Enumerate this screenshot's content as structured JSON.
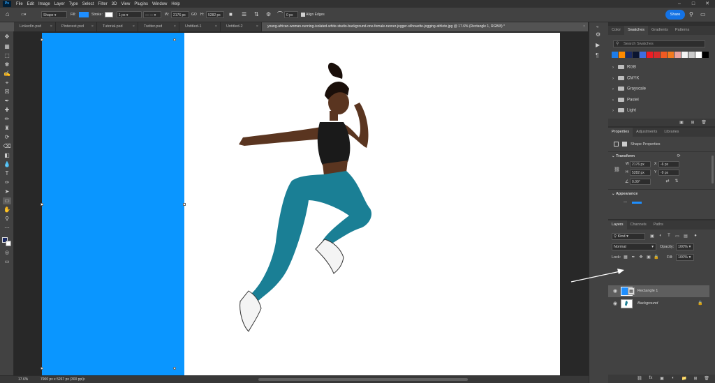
{
  "app": {
    "logo": "Ps",
    "menus": [
      "File",
      "Edit",
      "Image",
      "Layer",
      "Type",
      "Select",
      "Filter",
      "3D",
      "View",
      "Plugins",
      "Window",
      "Help"
    ]
  },
  "options_bar": {
    "tool_mode": "Shape",
    "fill_label": "Fill:",
    "stroke_label": "Stroke:",
    "stroke_width": "1 px",
    "w_label": "W:",
    "w_value": "2176 px",
    "link_icon": "GO",
    "h_label": "H:",
    "h_value": "5282 px",
    "radius_value": "0 px",
    "align_edges": "Align Edges",
    "share": "Share"
  },
  "tabs": [
    {
      "label": "LinkedIn.psd"
    },
    {
      "label": "Pinterest.psd"
    },
    {
      "label": "Tutorial.psd"
    },
    {
      "label": "Twitter.psd"
    },
    {
      "label": "Untitled-1"
    },
    {
      "label": "Untitled-2"
    },
    {
      "label": "young-african-woman-running-isolated-white-studio-background-one-female-runner-jogger-silhouette-jogging-athlete.jpg @ 17.6% (Rectangle 1, RGB/8) *"
    }
  ],
  "status": {
    "zoom": "17.6%",
    "doc_size": "7900 px x 5267 px (300 ppi)"
  },
  "colors": {
    "rect_fill": "#0a96ff",
    "fill_swatch": "#1f8fff",
    "accent": "#1473e6",
    "swatches": [
      "#1d7ce8",
      "#ff8a00",
      "#1c2b63",
      "#0b1530",
      "#3d6de0",
      "#ee1c24",
      "#d62b2b",
      "#f05a22",
      "#f27a1f",
      "#e9a2a0",
      "#f2f2f2",
      "#c9c9c9",
      "#ffffff",
      "#000000"
    ]
  },
  "swatches_panel": {
    "tabs": [
      "Color",
      "Swatches",
      "Gradients",
      "Patterns"
    ],
    "active_tab": "Swatches",
    "search_placeholder": "Search Swatches",
    "folders": [
      "RGB",
      "CMYK",
      "Grayscale",
      "Pastel",
      "Light"
    ]
  },
  "properties_panel": {
    "tabs": [
      "Properties",
      "Adjustments",
      "Libraries"
    ],
    "active_tab": "Properties",
    "shape_properties": "Shape Properties",
    "transform": "Transform",
    "w_label": "W",
    "w_value": "2176 px",
    "x_label": "X",
    "x_value": "-6 px",
    "h_label": "H",
    "h_value": "5282 px",
    "y_label": "Y",
    "y_value": "-9 px",
    "angle_value": "0.00°",
    "appearance": "Appearance"
  },
  "layers_panel": {
    "tabs": [
      "Layers",
      "Channels",
      "Paths"
    ],
    "active_tab": "Layers",
    "kind_label": "Kind",
    "blend_mode": "Normal",
    "opacity_label": "Opacity:",
    "opacity_value": "100%",
    "lock_label": "Lock:",
    "fill_label": "Fill:",
    "fill_value": "100%",
    "layers": [
      {
        "name": "Rectangle 1",
        "selected": true
      },
      {
        "name": "Background",
        "selected": false
      }
    ]
  }
}
